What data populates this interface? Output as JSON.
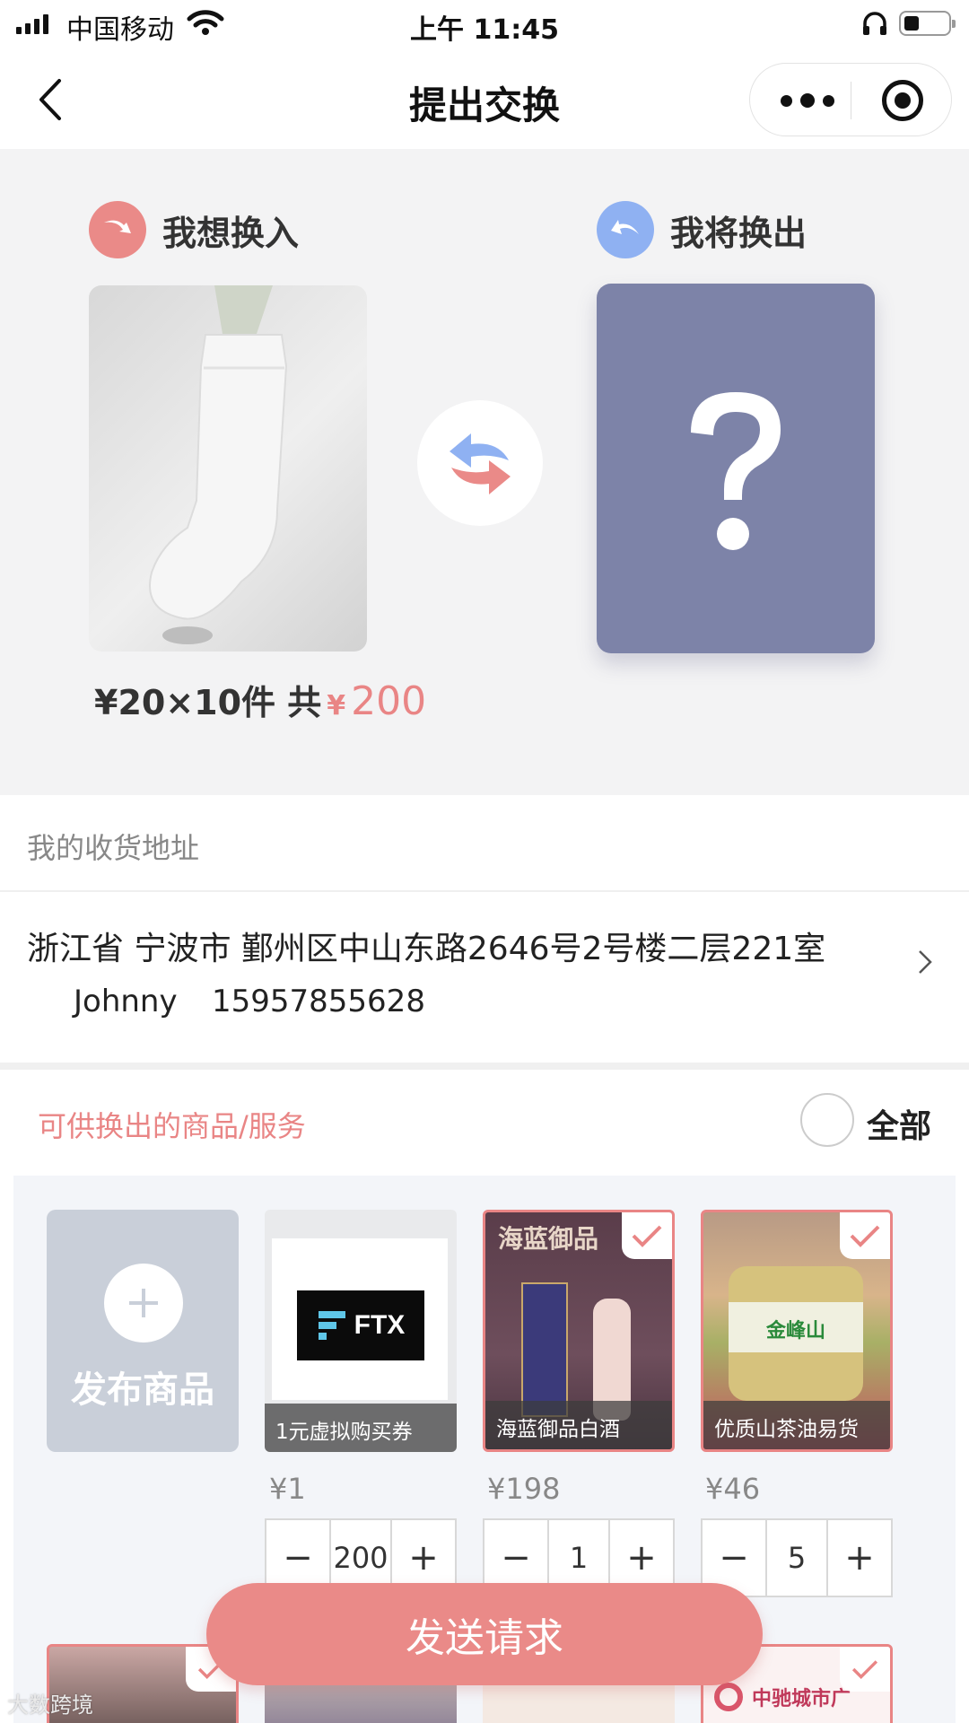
{
  "status_bar": {
    "carrier": "中国移动",
    "time": "上午 11:45"
  },
  "nav": {
    "title": "提出交换"
  },
  "exchange": {
    "want_label": "我想换入",
    "give_label": "我将换出",
    "price_text": "¥20×10件 共",
    "total_currency": "¥",
    "total_value": "200"
  },
  "address": {
    "section_label": "我的收货地址",
    "line": "浙江省 宁波市 鄞州区中山东路2646号2号楼二层221室",
    "name": "Johnny",
    "phone": "15957855628"
  },
  "goods": {
    "section_title": "可供换出的商品/服务",
    "select_all_label": "全部",
    "publish_label": "发布商品",
    "items": [
      {
        "title": "1元虚拟购买券",
        "price": "¥1",
        "quantity": "200",
        "selected": false,
        "logo_text": "FTX"
      },
      {
        "title": "海蓝御品白酒",
        "price": "¥198",
        "quantity": "1",
        "selected": true,
        "banner_text": "海蓝御品"
      },
      {
        "title": "优质山茶油易货",
        "price": "¥46",
        "quantity": "5",
        "selected": true,
        "label_text": "金峰山"
      }
    ],
    "row2_partial_text": "中驰城市广"
  },
  "stepper": {
    "minus": "−",
    "plus": "+"
  },
  "send_button": "发送请求",
  "watermark": "大数跨境",
  "colors": {
    "accent": "#ea8a88",
    "placeholder_bg": "#7d83a8",
    "give_icon_blue": "#8fb1f2"
  }
}
